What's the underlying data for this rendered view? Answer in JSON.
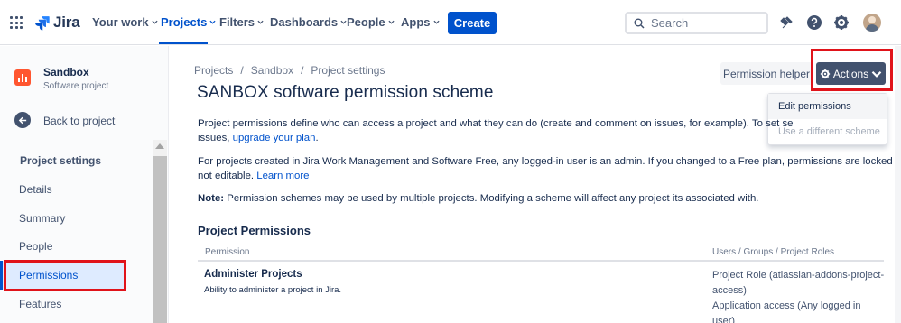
{
  "topnav": {
    "logo": "Jira",
    "items": [
      {
        "label": "Your work"
      },
      {
        "label": "Projects"
      },
      {
        "label": "Filters"
      },
      {
        "label": "Dashboards"
      },
      {
        "label": "People"
      },
      {
        "label": "Apps"
      }
    ],
    "active": "Projects",
    "create_label": "Create",
    "search_placeholder": "Search",
    "icons": [
      "app-switcher-icon",
      "search-icon",
      "notification-icon",
      "help-icon",
      "settings-icon",
      "avatar"
    ]
  },
  "sidebar": {
    "project_name": "Sandbox",
    "project_type": "Software project",
    "back_label": "Back to project",
    "section_title": "Project settings",
    "items": [
      {
        "label": "Details"
      },
      {
        "label": "Summary"
      },
      {
        "label": "People"
      },
      {
        "label": "Permissions"
      },
      {
        "label": "Features"
      }
    ],
    "active": "Permissions"
  },
  "main": {
    "breadcrumb": [
      "Projects",
      "Sandbox",
      "Project settings"
    ],
    "title": "SANBOX software permission scheme",
    "permission_helper_label": "Permission helper",
    "actions_label": "Actions",
    "actions_menu": [
      "Edit permissions",
      "Use a different scheme"
    ],
    "intro_line1": "Project permissions define who can access a project and what they can do (create and comment on issues, for example). To set se",
    "intro_line2_prefix": "issues, ",
    "intro_line2_link": "upgrade your plan",
    "intro_line2_suffix": ".",
    "free_line1": "For projects created in Jira Work Management and Software Free, any logged-in user is an admin. If you changed to a Free plan, permissions are locked and",
    "free_line2_prefix": "not editable. ",
    "free_line2_link": "Learn more",
    "note_label": "Note:",
    "note_text": " Permission schemes may be used by multiple projects. Modifying a scheme will affect any project its associated with.",
    "section_title": "Project Permissions",
    "table": {
      "col_permission": "Permission",
      "col_users": "Users / Groups / Project Roles",
      "rows": [
        {
          "name": "Administer Projects",
          "description": "Ability to administer a project in Jira.",
          "users_line1": "Project Role (atlassian-addons-project-",
          "users_line2": "access)",
          "users_line3": "Application access (Any logged in",
          "users_line4": "user)"
        }
      ]
    }
  },
  "colors": {
    "brand": "#0052cc",
    "actions_button": "#42526e",
    "highlight": "#e0131a"
  }
}
